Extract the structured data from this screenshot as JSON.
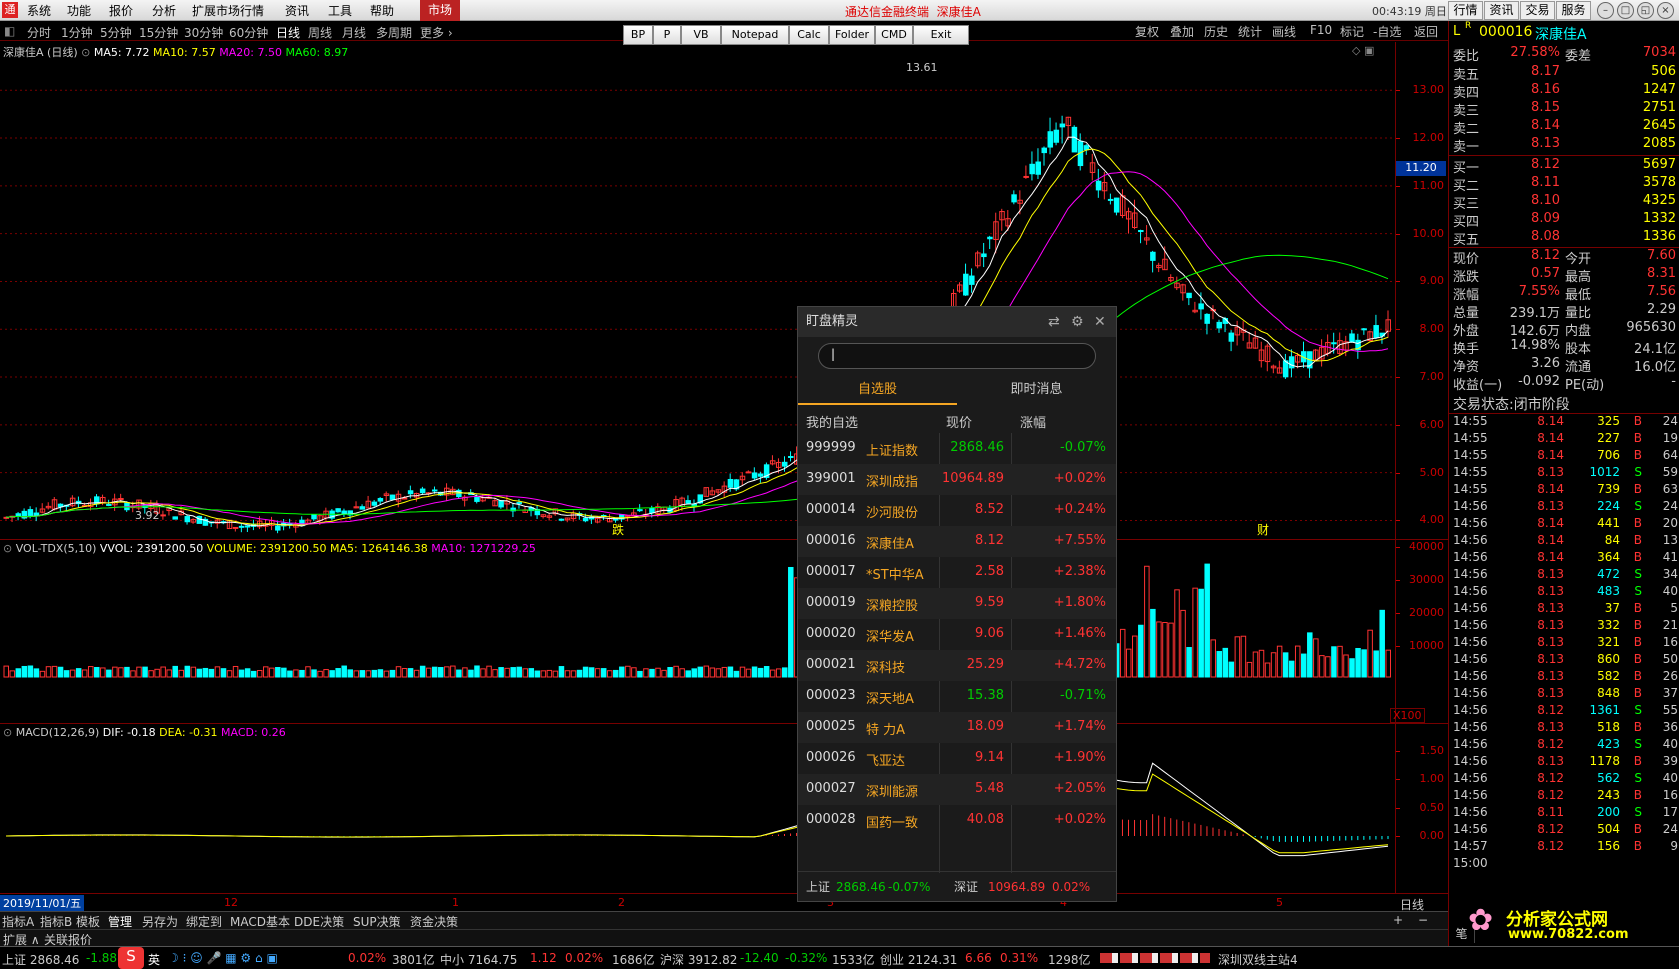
{
  "menu": [
    "系统",
    "功能",
    "报价",
    "分析",
    "扩展市场行情",
    "资讯",
    "工具",
    "帮助"
  ],
  "market_tab": "市场",
  "ad_text": "通达信金融终端",
  "window_stock": "深康佳A",
  "clock": "00:43:19 周日",
  "top_buttons": [
    "行情",
    "资讯",
    "交易",
    "服务"
  ],
  "periods": [
    "分时",
    "1分钟",
    "5分钟",
    "15分钟",
    "30分钟",
    "60分钟",
    "日线",
    "周线",
    "月线",
    "多周期",
    "更多"
  ],
  "toolbar": [
    "BP",
    "P",
    "VB",
    "Notepad",
    "Calc",
    "Folder",
    "CMD",
    "Exit"
  ],
  "right_tools": [
    "复权",
    "叠加",
    "历史",
    "统计",
    "画线",
    "F10",
    "标记",
    "-自选",
    "返回"
  ],
  "main_chart": {
    "title": "深康佳A (日线)",
    "ma5": "MA5: 7.72",
    "ma10": "MA10: 7.57",
    "ma20": "MA20: 7.50",
    "ma60": "MA60: 8.97",
    "high_label": "13.61",
    "low_label": "3.92",
    "marker1": "跌",
    "marker2": "财",
    "price_marker": "11.20",
    "y_ticks": [
      "13.00",
      "12.00",
      "11.00",
      "10.00",
      "9.00",
      "8.00",
      "7.00",
      "6.00",
      "5.00",
      "4.00"
    ]
  },
  "volume": {
    "title": "VOL-TDX(5,10)",
    "vvol": "VVOL: 2391200.50",
    "volume": "VOLUME: 2391200.50",
    "ma5": "MA5: 1264146.38",
    "ma10": "MA10: 1271229.25",
    "y_ticks": [
      "40000",
      "30000",
      "20000",
      "10000"
    ],
    "unit": "X100"
  },
  "macd": {
    "title": "MACD(12,26,9)",
    "dif": "DIF: -0.18",
    "dea": "DEA: -0.31",
    "macd": "MACD: 0.26",
    "y_ticks": [
      "1.50",
      "1.00",
      "0.50",
      "0.00"
    ]
  },
  "date_axis": {
    "current": "2019/11/01/五",
    "months": [
      "12",
      "1",
      "2",
      "3",
      "4",
      "5"
    ],
    "period": "日线"
  },
  "bottom_tabs": [
    "指标A",
    "指标B",
    "模板",
    "管理",
    "另存为",
    "绑定到",
    "MACD基本",
    "DDE决策",
    "SUP决策",
    "资金决策"
  ],
  "bottom_tabs2": [
    "扩展",
    "关联报价"
  ],
  "quote": {
    "code": "000016",
    "name": "深康佳A",
    "weibi_label": "委比",
    "weibi": "27.58%",
    "weicha_label": "委差",
    "weicha": "7034",
    "asks": [
      {
        "label": "卖五",
        "price": "8.17",
        "vol": "506"
      },
      {
        "label": "卖四",
        "price": "8.16",
        "vol": "1247"
      },
      {
        "label": "卖三",
        "price": "8.15",
        "vol": "2751"
      },
      {
        "label": "卖二",
        "price": "8.14",
        "vol": "2645"
      },
      {
        "label": "卖一",
        "price": "8.13",
        "vol": "2085"
      }
    ],
    "bids": [
      {
        "label": "买一",
        "price": "8.12",
        "vol": "5697"
      },
      {
        "label": "买二",
        "price": "8.11",
        "vol": "3578"
      },
      {
        "label": "买三",
        "price": "8.10",
        "vol": "4325"
      },
      {
        "label": "买四",
        "price": "8.09",
        "vol": "1332"
      },
      {
        "label": "买五",
        "price": "8.08",
        "vol": "1336"
      }
    ],
    "stats": [
      {
        "l1": "现价",
        "v1": "8.12",
        "l2": "今开",
        "v2": "7.60"
      },
      {
        "l1": "涨跌",
        "v1": "0.57",
        "l2": "最高",
        "v2": "8.31"
      },
      {
        "l1": "涨幅",
        "v1": "7.55%",
        "l2": "最低",
        "v2": "7.56"
      },
      {
        "l1": "总量",
        "v1": "239.1万",
        "l2": "量比",
        "v2": "2.29"
      },
      {
        "l1": "外盘",
        "v1": "142.6万",
        "l2": "内盘",
        "v2": "965630"
      },
      {
        "l1": "换手",
        "v1": "14.98%",
        "l2": "股本",
        "v2": "24.1亿"
      },
      {
        "l1": "净资",
        "v1": "3.26",
        "l2": "流通",
        "v2": "16.0亿"
      },
      {
        "l1": "收益(一)",
        "v1": "-0.092",
        "l2": "PE(动)",
        "v2": "-"
      }
    ],
    "trade_state": "交易状态:闭市阶段",
    "ticks": [
      {
        "t": "14:55",
        "p": "8.14",
        "v": "325",
        "d": "B",
        "n": "24"
      },
      {
        "t": "14:55",
        "p": "8.14",
        "v": "227",
        "d": "B",
        "n": "19"
      },
      {
        "t": "14:55",
        "p": "8.14",
        "v": "706",
        "d": "B",
        "n": "64"
      },
      {
        "t": "14:55",
        "p": "8.13",
        "v": "1012",
        "d": "S",
        "n": "59"
      },
      {
        "t": "14:55",
        "p": "8.14",
        "v": "739",
        "d": "B",
        "n": "63"
      },
      {
        "t": "14:56",
        "p": "8.13",
        "v": "224",
        "d": "S",
        "n": "24"
      },
      {
        "t": "14:56",
        "p": "8.14",
        "v": "441",
        "d": "B",
        "n": "20"
      },
      {
        "t": "14:56",
        "p": "8.14",
        "v": "84",
        "d": "B",
        "n": "13"
      },
      {
        "t": "14:56",
        "p": "8.14",
        "v": "364",
        "d": "B",
        "n": "41"
      },
      {
        "t": "14:56",
        "p": "8.13",
        "v": "472",
        "d": "S",
        "n": "34"
      },
      {
        "t": "14:56",
        "p": "8.13",
        "v": "483",
        "d": "S",
        "n": "40"
      },
      {
        "t": "14:56",
        "p": "8.13",
        "v": "37",
        "d": "B",
        "n": "5"
      },
      {
        "t": "14:56",
        "p": "8.13",
        "v": "332",
        "d": "B",
        "n": "21"
      },
      {
        "t": "14:56",
        "p": "8.13",
        "v": "321",
        "d": "B",
        "n": "16"
      },
      {
        "t": "14:56",
        "p": "8.13",
        "v": "860",
        "d": "B",
        "n": "50"
      },
      {
        "t": "14:56",
        "p": "8.13",
        "v": "582",
        "d": "B",
        "n": "26"
      },
      {
        "t": "14:56",
        "p": "8.13",
        "v": "848",
        "d": "B",
        "n": "37"
      },
      {
        "t": "14:56",
        "p": "8.12",
        "v": "1361",
        "d": "S",
        "n": "55"
      },
      {
        "t": "14:56",
        "p": "8.13",
        "v": "518",
        "d": "B",
        "n": "36"
      },
      {
        "t": "14:56",
        "p": "8.12",
        "v": "423",
        "d": "S",
        "n": "40"
      },
      {
        "t": "14:56",
        "p": "8.13",
        "v": "1178",
        "d": "B",
        "n": "39"
      },
      {
        "t": "14:56",
        "p": "8.12",
        "v": "562",
        "d": "S",
        "n": "40"
      },
      {
        "t": "14:56",
        "p": "8.12",
        "v": "243",
        "d": "B",
        "n": "16"
      },
      {
        "t": "14:56",
        "p": "8.11",
        "v": "200",
        "d": "S",
        "n": "17"
      },
      {
        "t": "14:56",
        "p": "8.12",
        "v": "504",
        "d": "B",
        "n": "24"
      },
      {
        "t": "14:57",
        "p": "8.12",
        "v": "156",
        "d": "B",
        "n": "9"
      },
      {
        "t": "15:00",
        "p": "",
        "v": "",
        "d": "",
        "n": ""
      }
    ],
    "foot_label": "笔"
  },
  "watchlist": {
    "title": "盯盘精灵",
    "tabs": [
      "自选股",
      "即时消息"
    ],
    "headers": [
      "我的自选",
      "现价",
      "涨幅"
    ],
    "rows": [
      {
        "code": "999999",
        "name": "上证指数",
        "price": "2868.46",
        "chg": "-0.07%",
        "up": false
      },
      {
        "code": "399001",
        "name": "深圳成指",
        "price": "10964.89",
        "chg": "+0.02%",
        "up": true
      },
      {
        "code": "000014",
        "name": "沙河股份",
        "price": "8.52",
        "chg": "+0.24%",
        "up": true
      },
      {
        "code": "000016",
        "name": "深康佳A",
        "price": "8.12",
        "chg": "+7.55%",
        "up": true
      },
      {
        "code": "000017",
        "name": "*ST中华A",
        "price": "2.58",
        "chg": "+2.38%",
        "up": true
      },
      {
        "code": "000019",
        "name": "深粮控股",
        "price": "9.59",
        "chg": "+1.80%",
        "up": true
      },
      {
        "code": "000020",
        "name": "深华发A",
        "price": "9.06",
        "chg": "+1.46%",
        "up": true
      },
      {
        "code": "000021",
        "name": "深科技",
        "price": "25.29",
        "chg": "+4.72%",
        "up": true
      },
      {
        "code": "000023",
        "name": "深天地A",
        "price": "15.38",
        "chg": "-0.71%",
        "up": false
      },
      {
        "code": "000025",
        "name": "特 力A",
        "price": "18.09",
        "chg": "+1.74%",
        "up": true
      },
      {
        "code": "000026",
        "name": "飞亚达",
        "price": "9.14",
        "chg": "+1.90%",
        "up": true
      },
      {
        "code": "000027",
        "name": "深圳能源",
        "price": "5.48",
        "chg": "+2.05%",
        "up": true
      },
      {
        "code": "000028",
        "name": "国药一致",
        "price": "40.08",
        "chg": "+0.02%",
        "up": true
      }
    ],
    "footer": {
      "sh_label": "上证",
      "sh_price": "2868.46",
      "sh_chg": "-0.07%",
      "sz_label": "深证",
      "sz_price": "10964.89",
      "sz_chg": "0.02%"
    }
  },
  "status": {
    "sh": "上证 2868.46",
    "sh_chg": "-1.88",
    "sh_pct": "0.02%",
    "sh_amt": "3801亿",
    "zx": "中小 7164.75",
    "zx_chg": "1.12",
    "zx_pct": "0.02%",
    "zx_amt": "1686亿",
    "hs": "沪深 3912.82",
    "hs_chg": "-12.40",
    "hs_pct": "-0.32%",
    "hs_amt": "1533亿",
    "cy": "创业 2124.31",
    "cy_chg": "6.66",
    "cy_pct": "0.31%",
    "cy_amt": "1298亿",
    "server": "深圳双线主站4",
    "ime": "英"
  },
  "watermark": {
    "line1": "分析家公式网",
    "line2": "www.70822.com"
  },
  "colors": {
    "up": "#ff3333",
    "down": "#00ffff",
    "ma5": "#ffffff",
    "ma10": "#ffff00",
    "ma20": "#ff00ff",
    "ma60": "#00ff00",
    "grid": "#7a0000",
    "amber": "#f5a623"
  }
}
